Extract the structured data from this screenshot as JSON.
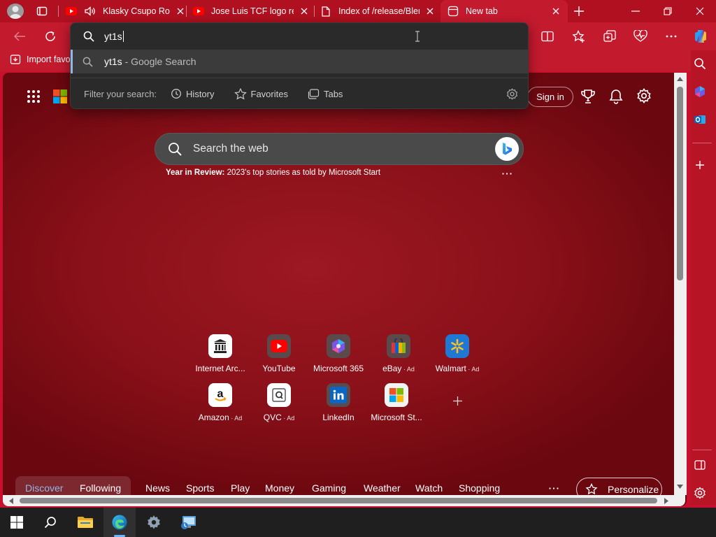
{
  "tabs": [
    {
      "label": "Klasky Csupo Rol"
    },
    {
      "label": "Jose Luis TCF logo ren"
    },
    {
      "label": "Index of /release/Blen"
    },
    {
      "label": "New tab"
    }
  ],
  "omnibox": {
    "query": "yt1s",
    "suggestion_query": "yt1s",
    "suggestion_source": " - Google Search",
    "filter_label": "Filter your search:",
    "filters": [
      "History",
      "Favorites",
      "Tabs"
    ]
  },
  "favorites_bar": {
    "import_label": "Import favo"
  },
  "header": {
    "sign_in": "Sign in"
  },
  "search": {
    "placeholder": "Search the web"
  },
  "year_review": {
    "bold": "Year in Review:",
    "text": " 2023's top stories as told by Microsoft Start"
  },
  "tiles_row1": [
    {
      "label": "Internet Arc...",
      "ad": ""
    },
    {
      "label": "YouTube",
      "ad": ""
    },
    {
      "label": "Microsoft 365",
      "ad": ""
    },
    {
      "label": "eBay",
      "ad": " · Ad"
    },
    {
      "label": "Walmart",
      "ad": " · Ad"
    }
  ],
  "tiles_row2": [
    {
      "label": "Amazon",
      "ad": " · Ad"
    },
    {
      "label": "QVC",
      "ad": " · Ad"
    },
    {
      "label": "LinkedIn",
      "ad": ""
    },
    {
      "label": "Microsoft St...",
      "ad": ""
    }
  ],
  "feed_nav": [
    "Discover",
    "Following",
    "News",
    "Sports",
    "Play",
    "Money",
    "Gaming",
    "Weather",
    "Watch",
    "Shopping"
  ],
  "personalize": "Personalize",
  "colors": {
    "theme": "#c8102e",
    "omnibox": "#2a2a2a",
    "accent": "#8fb8e6"
  }
}
